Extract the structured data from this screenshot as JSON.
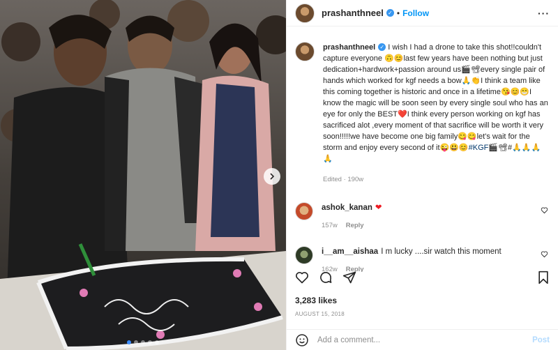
{
  "post": {
    "username": "prashanthneel",
    "follow_label": "Follow",
    "separator": "•",
    "caption": "I wish I had a drone to take this shot!!couldn't capture everyone 🙃😊last few years have been nothing but just dedication+hardwork+passion around us🎬📽every single pair of hands which worked for kgf needs a bow🙏👏I think a team like this coming together is historic and once in a lifetime😘😊😁I know the magic will be soon seen by every single soul who has an eye for only the BEST❤️I think every person working on kgf has sacrificed alot ,every moment of that sacrifice will be worth it very soon!!!!!we have become one big family😋😋let's wait for the storm and enjoy every second of it😜😃😊",
    "hashtag": "#KGF",
    "caption_tail": "🎬📽#🙏🙏🙏🙏",
    "caption_meta": "Edited · 190w",
    "likes": "3,283 likes",
    "date": "AUGUST 15, 2018",
    "comment_placeholder": "Add a comment...",
    "post_label": "Post"
  },
  "comments": [
    {
      "username": "ashok_kanan",
      "text": "❤",
      "age": "157w",
      "reply_label": "Reply"
    },
    {
      "username": "i__am__aishaa",
      "text": "I m lucky ....sir watch this moment",
      "age": "162w",
      "reply_label": "Reply"
    }
  ],
  "carousel": {
    "slide_count": 5,
    "active_index": 0
  },
  "icons": {
    "verified": "verified-badge-icon",
    "more": "more-options-icon",
    "like": "heart-icon",
    "comment": "comment-bubble-icon",
    "share": "paper-plane-icon",
    "save": "bookmark-icon",
    "emoji": "smiley-icon",
    "next": "chevron-right-icon"
  },
  "colors": {
    "accent": "#0095f6",
    "verified": "#3897f0",
    "post_disabled": "#b3dbff",
    "heart": "#ed1c24"
  }
}
